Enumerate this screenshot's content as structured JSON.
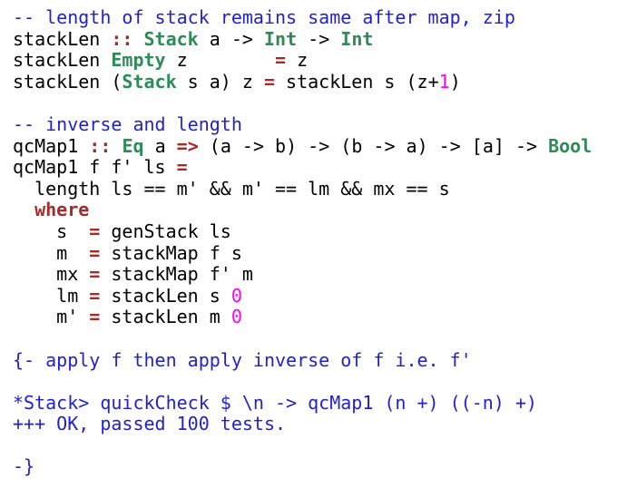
{
  "colors": {
    "comment": "#1f1fd8",
    "keyword": "#2e8b57",
    "operator": "#a52a2a",
    "number": "#ff00ff",
    "plain": "#000000"
  },
  "code_lines": [
    [
      {
        "t": "-- length of stack remains same after map, zip",
        "c": "comment"
      }
    ],
    [
      {
        "t": "stackLen ",
        "c": "plain"
      },
      {
        "t": "::",
        "c": "operator"
      },
      {
        "t": " ",
        "c": "plain"
      },
      {
        "t": "Stack",
        "c": "keyword"
      },
      {
        "t": " a -> ",
        "c": "plain"
      },
      {
        "t": "Int",
        "c": "keyword"
      },
      {
        "t": " -> ",
        "c": "plain"
      },
      {
        "t": "Int",
        "c": "keyword"
      }
    ],
    [
      {
        "t": "stackLen ",
        "c": "plain"
      },
      {
        "t": "Empty",
        "c": "keyword"
      },
      {
        "t": " z        ",
        "c": "plain"
      },
      {
        "t": "=",
        "c": "operator"
      },
      {
        "t": " z",
        "c": "plain"
      }
    ],
    [
      {
        "t": "stackLen (",
        "c": "plain"
      },
      {
        "t": "Stack",
        "c": "keyword"
      },
      {
        "t": " s a) z ",
        "c": "plain"
      },
      {
        "t": "=",
        "c": "operator"
      },
      {
        "t": " stackLen s (z+",
        "c": "plain"
      },
      {
        "t": "1",
        "c": "number"
      },
      {
        "t": ")",
        "c": "plain"
      }
    ],
    [],
    [
      {
        "t": "-- inverse and length",
        "c": "comment"
      }
    ],
    [
      {
        "t": "qcMap1 ",
        "c": "plain"
      },
      {
        "t": "::",
        "c": "operator"
      },
      {
        "t": " ",
        "c": "plain"
      },
      {
        "t": "Eq",
        "c": "keyword"
      },
      {
        "t": " a ",
        "c": "plain"
      },
      {
        "t": "=>",
        "c": "operator"
      },
      {
        "t": " (a -> b) -> (b -> a) -> [a] -> ",
        "c": "plain"
      },
      {
        "t": "Bool",
        "c": "keyword"
      }
    ],
    [
      {
        "t": "qcMap1 f f' ls ",
        "c": "plain"
      },
      {
        "t": "=",
        "c": "operator"
      }
    ],
    [
      {
        "t": "  length ls == m' && m' == lm && mx == s",
        "c": "plain"
      }
    ],
    [
      {
        "t": "  ",
        "c": "plain"
      },
      {
        "t": "where",
        "c": "operator"
      }
    ],
    [
      {
        "t": "    s  ",
        "c": "plain"
      },
      {
        "t": "=",
        "c": "operator"
      },
      {
        "t": " genStack ls",
        "c": "plain"
      }
    ],
    [
      {
        "t": "    m  ",
        "c": "plain"
      },
      {
        "t": "=",
        "c": "operator"
      },
      {
        "t": " stackMap f s",
        "c": "plain"
      }
    ],
    [
      {
        "t": "    mx ",
        "c": "plain"
      },
      {
        "t": "=",
        "c": "operator"
      },
      {
        "t": " stackMap f' m",
        "c": "plain"
      }
    ],
    [
      {
        "t": "    lm ",
        "c": "plain"
      },
      {
        "t": "=",
        "c": "operator"
      },
      {
        "t": " stackLen s ",
        "c": "plain"
      },
      {
        "t": "0",
        "c": "number"
      }
    ],
    [
      {
        "t": "    m' ",
        "c": "plain"
      },
      {
        "t": "=",
        "c": "operator"
      },
      {
        "t": " stackLen m ",
        "c": "plain"
      },
      {
        "t": "0",
        "c": "number"
      }
    ],
    [],
    [
      {
        "t": "{- apply f then apply inverse of f i.e. f'",
        "c": "comment"
      }
    ],
    [],
    [
      {
        "t": "*Stack> quickCheck $ \\n -> qcMap1 (n +) ((-n) +)",
        "c": "comment"
      }
    ],
    [
      {
        "t": "+++ OK, passed 100 tests.",
        "c": "comment"
      }
    ],
    [],
    [
      {
        "t": "-}",
        "c": "comment"
      }
    ]
  ]
}
